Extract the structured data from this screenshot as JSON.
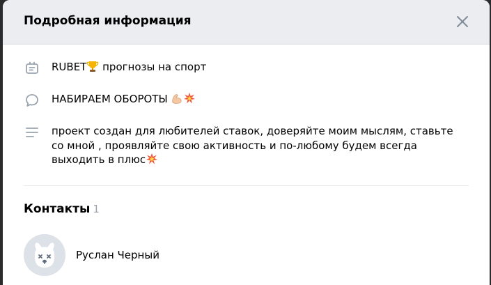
{
  "modal": {
    "title": "Подробная информация"
  },
  "info": {
    "status_text": "RUBET",
    "status_suffix": "прогнозы на спорт",
    "slogan_text": "НАБИРАЕМ ОБОРОТЫ",
    "description": "проект создан для любителей ставок, доверяйте моим мыслям, ставьте со мной , проявляйте свою активность и по-любому будем всегда выходить в плюс"
  },
  "contacts": {
    "title": "Контакты",
    "count": "1",
    "items": [
      {
        "name": "Руслан Черный"
      }
    ]
  },
  "icons": {
    "close": "close-icon",
    "status": "status-icon",
    "comment": "comment-icon",
    "description": "text-lines-icon",
    "trophy": "trophy-emoji",
    "muscle": "flexed-biceps-emoji",
    "collision": "collision-emoji"
  },
  "colors": {
    "header_bg": "#ebedf0",
    "icon_gray": "#99a2ad",
    "text": "#000000",
    "count_gray": "#99a2ad"
  }
}
